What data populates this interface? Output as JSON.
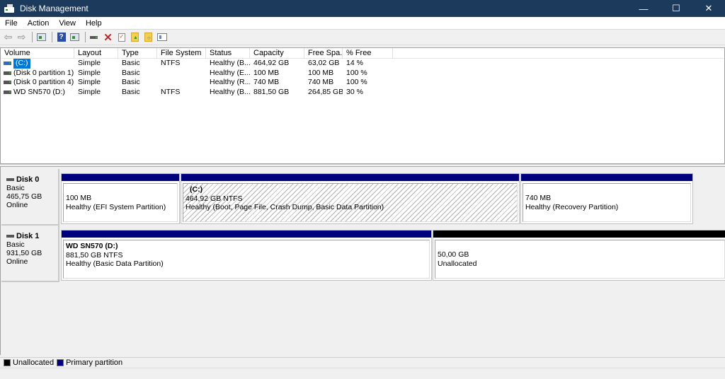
{
  "window": {
    "title": "Disk Management",
    "controls": {
      "minimize": "—",
      "maximize": "☐",
      "close": "✕"
    }
  },
  "menu": [
    "File",
    "Action",
    "View",
    "Help"
  ],
  "toolbar": {
    "icons": [
      "back-arrow",
      "forward-arrow",
      "show-hide-console-tree",
      "help",
      "show-action-pane",
      "connect-drive",
      "delete",
      "properties",
      "up-folder",
      "find-folder",
      "list-view"
    ]
  },
  "volume_list": {
    "columns": [
      "Volume",
      "Layout",
      "Type",
      "File System",
      "Status",
      "Capacity",
      "Free Spa...",
      "% Free"
    ],
    "rows": [
      {
        "volume": "(C:)",
        "layout": "Simple",
        "type": "Basic",
        "fs": "NTFS",
        "status": "Healthy (B...",
        "capacity": "464,92 GB",
        "free": "63,02 GB",
        "pct": "14 %",
        "selected": true
      },
      {
        "volume": "(Disk 0 partition 1)",
        "layout": "Simple",
        "type": "Basic",
        "fs": "",
        "status": "Healthy (E...",
        "capacity": "100 MB",
        "free": "100 MB",
        "pct": "100 %",
        "selected": false
      },
      {
        "volume": "(Disk 0 partition 4)",
        "layout": "Simple",
        "type": "Basic",
        "fs": "",
        "status": "Healthy (R...",
        "capacity": "740 MB",
        "free": "740 MB",
        "pct": "100 %",
        "selected": false
      },
      {
        "volume": "WD SN570 (D:)",
        "layout": "Simple",
        "type": "Basic",
        "fs": "NTFS",
        "status": "Healthy (B...",
        "capacity": "881,50 GB",
        "free": "264,85 GB",
        "pct": "30 %",
        "selected": false
      }
    ]
  },
  "disks": [
    {
      "name": "Disk 0",
      "type": "Basic",
      "size": "465,75 GB",
      "state": "Online",
      "partitions": [
        {
          "label": "",
          "size": "100 MB",
          "status": "Healthy (EFI System Partition)",
          "kind": "primary"
        },
        {
          "label": "(C:)",
          "size": "464,92 GB NTFS",
          "status": "Healthy (Boot, Page File, Crash Dump, Basic Data Partition)",
          "kind": "primary",
          "selected": true
        },
        {
          "label": "",
          "size": "740 MB",
          "status": "Healthy (Recovery Partition)",
          "kind": "primary"
        }
      ]
    },
    {
      "name": "Disk 1",
      "type": "Basic",
      "size": "931,50 GB",
      "state": "Online",
      "partitions": [
        {
          "label": "WD SN570  (D:)",
          "size": "881,50 GB NTFS",
          "status": "Healthy (Basic Data Partition)",
          "kind": "primary"
        },
        {
          "label": "",
          "size": "50,00 GB",
          "status": "Unallocated",
          "kind": "unallocated"
        }
      ]
    }
  ],
  "legend": [
    {
      "label": "Unallocated",
      "color": "#000000"
    },
    {
      "label": "Primary partition",
      "color": "#00007f"
    }
  ]
}
